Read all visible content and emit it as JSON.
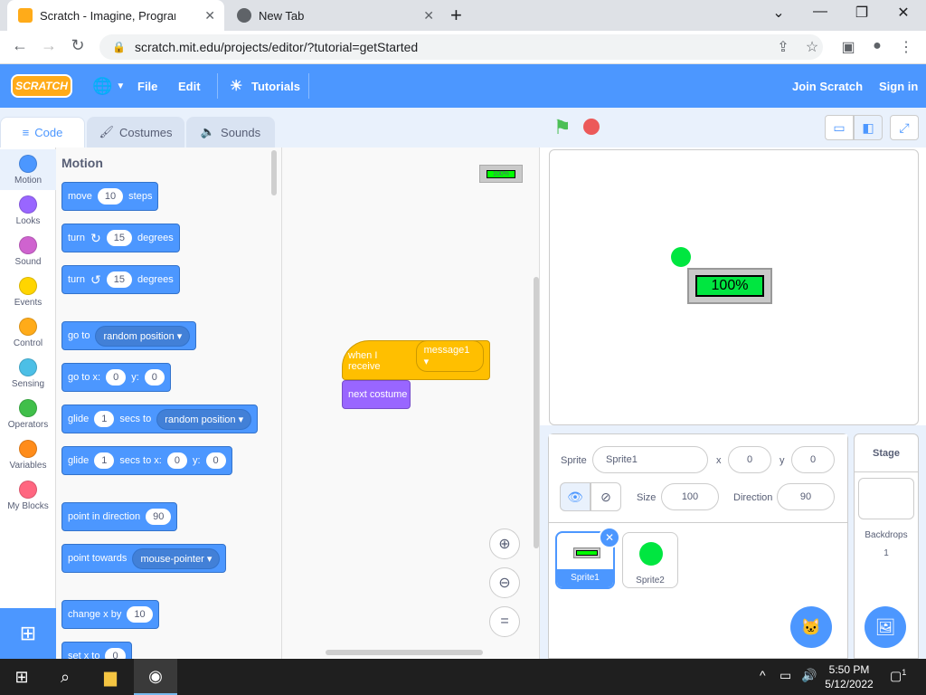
{
  "browser": {
    "tabs": [
      {
        "title": "Scratch - Imagine, Program, Shar",
        "active": true
      },
      {
        "title": "New Tab",
        "active": false
      }
    ],
    "new_tab_symbol": "+",
    "url": "scratch.mit.edu/projects/editor/?tutorial=getStarted",
    "icons": [
      "back-icon",
      "forward-icon",
      "reload-icon",
      "lock-icon",
      "share-icon",
      "star-icon",
      "sidepanel-icon",
      "profile-icon",
      "more-icon"
    ]
  },
  "menu": {
    "logo": "SCRATCH",
    "file": "File",
    "edit": "Edit",
    "tutorials": "Tutorials",
    "join": "Join Scratch",
    "signin": "Sign in",
    "accent": "#4c97ff"
  },
  "editor_tabs": {
    "code": "Code",
    "costumes": "Costumes",
    "sounds": "Sounds"
  },
  "categories": [
    {
      "label": "Motion",
      "color": "#4c97ff"
    },
    {
      "label": "Looks",
      "color": "#9966ff"
    },
    {
      "label": "Sound",
      "color": "#cf63cf"
    },
    {
      "label": "Events",
      "color": "#ffd500"
    },
    {
      "label": "Control",
      "color": "#ffab19"
    },
    {
      "label": "Sensing",
      "color": "#4cbfe6"
    },
    {
      "label": "Operators",
      "color": "#40bf4a"
    },
    {
      "label": "Variables",
      "color": "#ff8c1a"
    },
    {
      "label": "My Blocks",
      "color": "#ff6680"
    }
  ],
  "palette": {
    "title": "Motion",
    "move": {
      "a": "move",
      "v": "10",
      "b": "steps"
    },
    "turn_right": {
      "a": "turn",
      "v": "15",
      "b": "degrees"
    },
    "turn_left": {
      "a": "turn",
      "v": "15",
      "b": "degrees"
    },
    "goto": {
      "a": "go to",
      "dd": "random position"
    },
    "gotoxy": {
      "a": "go to x:",
      "x": "0",
      "b": "y:",
      "y": "0"
    },
    "glide": {
      "a": "glide",
      "v": "1",
      "b": "secs to",
      "dd": "random position"
    },
    "glidexy": {
      "a": "glide",
      "v": "1",
      "b": "secs to x:",
      "x": "0",
      "c": "y:",
      "y": "0"
    },
    "point_dir": {
      "a": "point in direction",
      "v": "90"
    },
    "point_towards": {
      "a": "point towards",
      "dd": "mouse-pointer"
    },
    "change_x": {
      "a": "change x by",
      "v": "10"
    },
    "set_x": {
      "a": "set x to",
      "v": "0"
    }
  },
  "script": {
    "thumb": "100%",
    "hat_label": "when I receive",
    "hat_dd": "message1",
    "looks_block": "next costume"
  },
  "stage": {
    "battery_text": "100%"
  },
  "sprite_info": {
    "sprite_label": "Sprite",
    "sprite_name": "Sprite1",
    "x_label": "x",
    "x": "0",
    "y_label": "y",
    "y": "0",
    "show_label": "Show",
    "size_label": "Size",
    "size": "100",
    "direction_label": "Direction",
    "direction": "90"
  },
  "sprites": [
    {
      "name": "Sprite1"
    },
    {
      "name": "Sprite2"
    }
  ],
  "stage_panel": {
    "title": "Stage",
    "backdrops_label": "Backdrops",
    "backdrops_count": "1"
  },
  "taskbar": {
    "time": "5:50 PM",
    "date": "5/12/2022",
    "notifications": "1"
  }
}
